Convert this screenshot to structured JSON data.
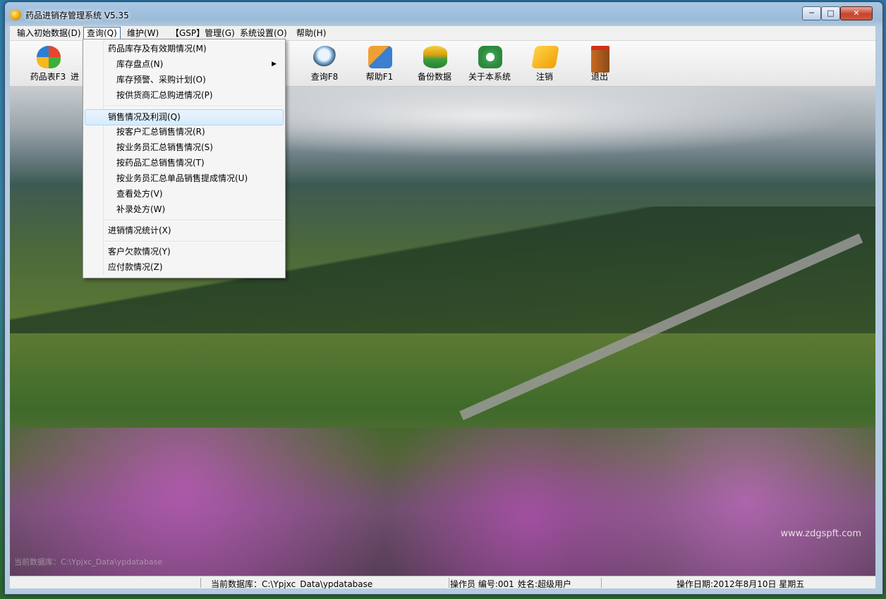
{
  "window": {
    "title": "药品进销存管理系统 V5.35"
  },
  "controls": {
    "min": "─",
    "max": "□",
    "close": "✕"
  },
  "menubar": [
    {
      "label": "输入初始数据(D)"
    },
    {
      "label": "查询(Q)"
    },
    {
      "label": "维护(W)"
    },
    {
      "label": "【GSP】管理(G)"
    },
    {
      "label": "系统设置(O)"
    },
    {
      "label": "帮助(H)"
    }
  ],
  "toolbar": [
    {
      "label": "药品表F3",
      "icon": "windows-logo-icon"
    },
    {
      "label": "进",
      "icon": "stock-in-icon"
    },
    {
      "label": "查询F8",
      "icon": "magnifier-icon"
    },
    {
      "label": "帮助F1",
      "icon": "help-cubes-icon"
    },
    {
      "label": "备份数据",
      "icon": "database-backup-icon"
    },
    {
      "label": "关于本系统",
      "icon": "home-about-icon"
    },
    {
      "label": "注销",
      "icon": "key-logout-icon"
    },
    {
      "label": "退出",
      "icon": "exit-door-icon"
    }
  ],
  "dropdown": {
    "items": [
      {
        "label": "药品库存及有效期情况(M)"
      },
      {
        "label": "库存盘点(N)",
        "submenu": true
      },
      {
        "label": "库存预警、采购计划(O)"
      },
      {
        "label": "按供货商汇总购进情况(P)"
      },
      {
        "label": "销售情况及利润(Q)"
      },
      {
        "label": "按客户汇总销售情况(R)"
      },
      {
        "label": "按业务员汇总销售情况(S)"
      },
      {
        "label": "按药品汇总销售情况(T)"
      },
      {
        "label": "按业务员汇总单品销售提成情况(U)"
      },
      {
        "label": "查看处方(V)"
      },
      {
        "label": "补录处方(W)"
      },
      {
        "label": "进销情况统计(X)"
      },
      {
        "label": "客户欠款情况(Y)"
      },
      {
        "label": "应付款情况(Z)"
      }
    ]
  },
  "background": {
    "watermark": "www.zdgspft.com",
    "faint_text": "当前数据库：C:\\Ypjxc_Data\\ypdatabase"
  },
  "status": {
    "database": "当前数据库：C:\\Ypjxc_Data\\ypdatabase",
    "operator": "操作员 编号:001",
    "name": "姓名:超级用户",
    "date": "操作日期:2012年8月10日 星期五"
  }
}
